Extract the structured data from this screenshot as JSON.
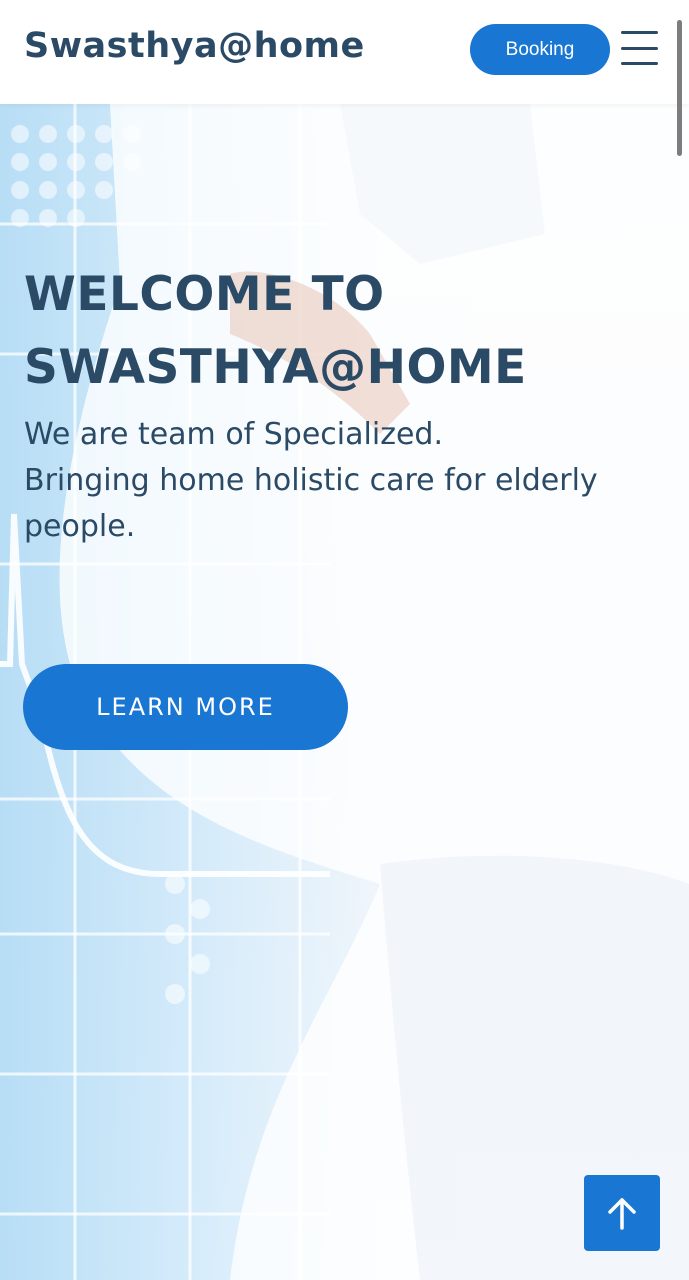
{
  "header": {
    "logo": "Swasthya@home",
    "booking_label": "Booking",
    "menu_icon": "hamburger-menu-icon"
  },
  "hero": {
    "title": "WELCOME TO SWASTHYA@HOME",
    "subtitle": "We are team of Specialized.\nBringing home holistic care for elderly people.",
    "cta_label": "LEARN MORE"
  },
  "back_to_top": {
    "icon": "arrow-up-icon"
  },
  "colors": {
    "accent": "#1976d2",
    "text_dark": "#2b4a66",
    "background": "#ffffff"
  }
}
